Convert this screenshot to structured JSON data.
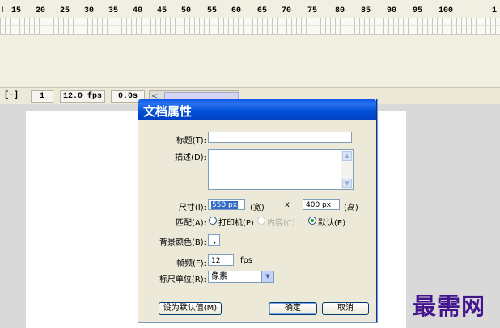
{
  "ruler": [
    "15",
    "20",
    "25",
    "30",
    "35",
    "40",
    "45",
    "50",
    "55",
    "60",
    "65",
    "70",
    "75",
    "80",
    "85",
    "90",
    "95",
    "100"
  ],
  "statusbar": {
    "center_icon": "[·]",
    "frame": "1",
    "fps": "12.0 fps",
    "time": "0.0s",
    "scroll_arrow": "<"
  },
  "dialog": {
    "title": "文档属性",
    "title_label": "标题(T):",
    "desc_label": "描述(D):",
    "size_label": "尺寸(I):",
    "width_value": "550 px",
    "width_unit": "(宽)",
    "x": "x",
    "height_value": "400 px",
    "height_unit": "(高)",
    "match_label": "匹配(A):",
    "match_printer": "打印机(P)",
    "match_contents": "内容(C)",
    "match_default": "默认(E)",
    "bg_label": "背景颜色(B):",
    "fps_label": "帧频(F):",
    "fps_value": "12",
    "fps_unit": "fps",
    "units_label": "标尺单位(R):",
    "units_value": "像素",
    "btn_make_default": "设为默认值(M)",
    "btn_ok": "确定",
    "btn_cancel": "取消"
  },
  "watermark": "最需网",
  "colors": {
    "titlebar": "#0050d8",
    "dialog_bg": "#ece9d8",
    "watermark": "#44148f"
  }
}
